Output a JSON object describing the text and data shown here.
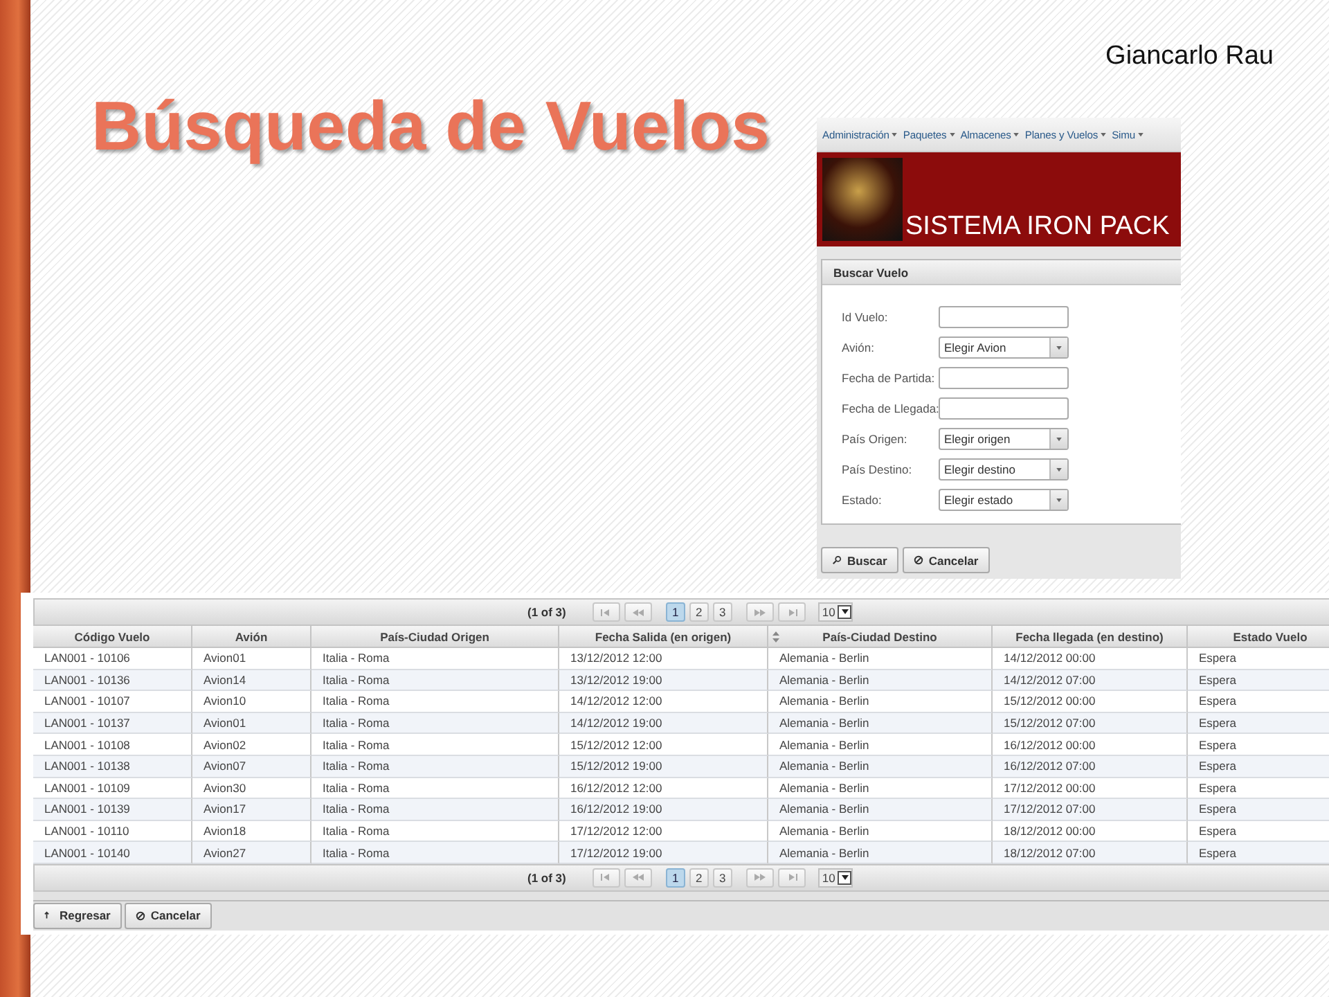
{
  "slide": {
    "title": "Búsqueda de Vuelos",
    "author": "Giancarlo Rau"
  },
  "search_app": {
    "menu": [
      "Administración",
      "Paquetes",
      "Almacenes",
      "Planes y Vuelos",
      "Simu"
    ],
    "banner_title": "SISTEMA IRON PACK",
    "panel_title": "Buscar Vuelo",
    "fields": [
      {
        "label": "Id Vuelo:",
        "kind": "text"
      },
      {
        "label": "Avión:",
        "kind": "select",
        "value": "Elegir Avion"
      },
      {
        "label": "Fecha de Partida:",
        "kind": "text"
      },
      {
        "label": "Fecha de Llegada:",
        "kind": "text"
      },
      {
        "label": "País Origen:",
        "kind": "select",
        "value": "Elegir origen"
      },
      {
        "label": "País Destino:",
        "kind": "select",
        "value": "Elegir destino"
      },
      {
        "label": "Estado:",
        "kind": "select",
        "value": "Elegir estado"
      }
    ],
    "buttons": [
      {
        "label": "Buscar",
        "kind": "search"
      },
      {
        "label": "Cancelar",
        "kind": "cancel"
      }
    ]
  },
  "results_app": {
    "paginator_top": {
      "summary": "(1 of 3)",
      "pages": [
        {
          "label": "1",
          "selected": true
        },
        {
          "label": "2",
          "selected": false
        },
        {
          "label": "3",
          "selected": false
        }
      ],
      "rows_per_page": "10"
    },
    "columns": [
      {
        "label": "Código Vuelo",
        "sortable": false
      },
      {
        "label": "Avión",
        "sortable": false
      },
      {
        "label": "País-Ciudad Origen",
        "sortable": false
      },
      {
        "label": "Fecha Salida (en origen)",
        "sortable": false
      },
      {
        "label": "País-Ciudad Destino",
        "sortable": true
      },
      {
        "label": "Fecha llegada (en destino)",
        "sortable": false
      },
      {
        "label": "Estado Vuelo",
        "sortable": false
      }
    ],
    "rows": [
      [
        "LAN001 - 10106",
        "Avion01",
        "Italia - Roma",
        "13/12/2012 12:00",
        "Alemania - Berlin",
        "14/12/2012 00:00",
        "Espera"
      ],
      [
        "LAN001 - 10136",
        "Avion14",
        "Italia - Roma",
        "13/12/2012 19:00",
        "Alemania - Berlin",
        "14/12/2012 07:00",
        "Espera"
      ],
      [
        "LAN001 - 10107",
        "Avion10",
        "Italia - Roma",
        "14/12/2012 12:00",
        "Alemania - Berlin",
        "15/12/2012 00:00",
        "Espera"
      ],
      [
        "LAN001 - 10137",
        "Avion01",
        "Italia - Roma",
        "14/12/2012 19:00",
        "Alemania - Berlin",
        "15/12/2012 07:00",
        "Espera"
      ],
      [
        "LAN001 - 10108",
        "Avion02",
        "Italia - Roma",
        "15/12/2012 12:00",
        "Alemania - Berlin",
        "16/12/2012 00:00",
        "Espera"
      ],
      [
        "LAN001 - 10138",
        "Avion07",
        "Italia - Roma",
        "15/12/2012 19:00",
        "Alemania - Berlin",
        "16/12/2012 07:00",
        "Espera"
      ],
      [
        "LAN001 - 10109",
        "Avion30",
        "Italia - Roma",
        "16/12/2012 12:00",
        "Alemania - Berlin",
        "17/12/2012 00:00",
        "Espera"
      ],
      [
        "LAN001 - 10139",
        "Avion17",
        "Italia - Roma",
        "16/12/2012 19:00",
        "Alemania - Berlin",
        "17/12/2012 07:00",
        "Espera"
      ],
      [
        "LAN001 - 10110",
        "Avion18",
        "Italia - Roma",
        "17/12/2012 12:00",
        "Alemania - Berlin",
        "18/12/2012 00:00",
        "Espera"
      ],
      [
        "LAN001 - 10140",
        "Avion27",
        "Italia - Roma",
        "17/12/2012 19:00",
        "Alemania - Berlin",
        "18/12/2012 07:00",
        "Espera"
      ]
    ],
    "paginator_bottom": {
      "summary": "(1 of 3)",
      "pages": [
        {
          "label": "1",
          "selected": true
        },
        {
          "label": "2",
          "selected": false
        },
        {
          "label": "3",
          "selected": false
        }
      ],
      "rows_per_page": "10"
    },
    "buttons": [
      {
        "label": "Regresar",
        "kind": "back"
      },
      {
        "label": "Cancelar",
        "kind": "cancel"
      }
    ]
  }
}
